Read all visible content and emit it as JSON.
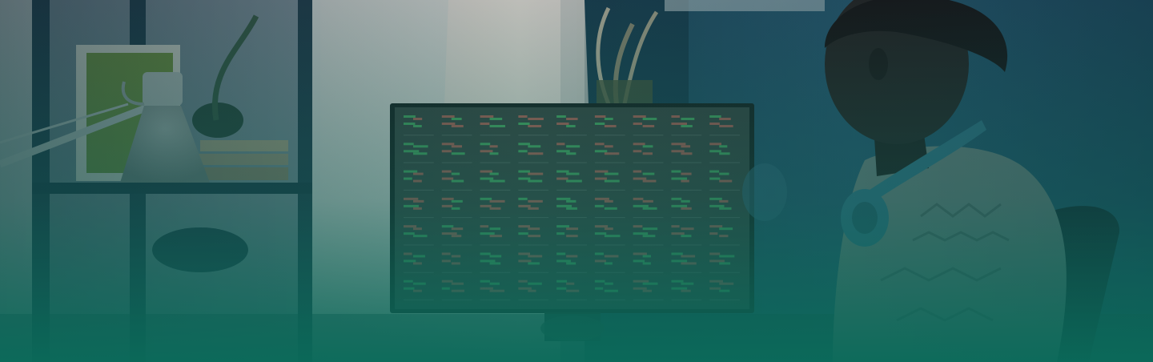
{
  "scene": {
    "description_tags": [
      "person",
      "headphones",
      "monitor",
      "stock-grid",
      "desk-lamp",
      "shelf",
      "plant"
    ],
    "colors": {
      "wall_left": "#d9dcd8",
      "wall_right": "#2a5f7a",
      "overlay_bottom": "#0d6b5c",
      "screen_bg": "#3d4a44",
      "tick_green": "#4fbf6a",
      "tick_red": "#c96a5a",
      "headphones": "#3a7f93",
      "skin": "#2b2522",
      "shirt": "#7d8e8a"
    },
    "monitor": {
      "rows": 7,
      "cols": 9
    }
  }
}
